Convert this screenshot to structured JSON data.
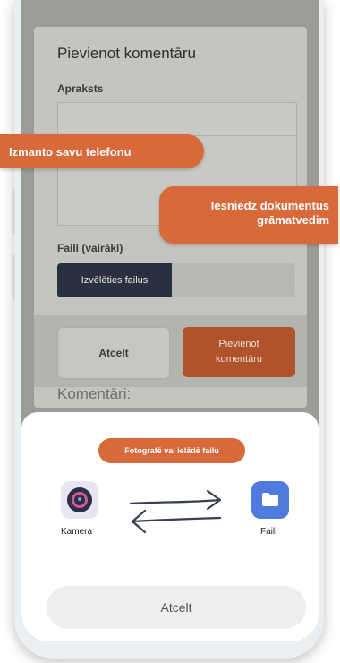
{
  "dialog": {
    "title": "Pievienot komentāru",
    "description_label": "Apraksts",
    "files_label": "Faili (vairāki)",
    "choose_files_button": "Izvēlēties failus",
    "cancel_button": "Atcelt",
    "submit_button_line1": "Pievienot",
    "submit_button_line2": "komentāru"
  },
  "comments_heading": "Komentāri:",
  "callouts": {
    "use_phone": "Izmanto savu telefonu",
    "submit_docs_line1": "Iesniedz dokumentus",
    "submit_docs_line2": "grāmatvedim"
  },
  "sheet": {
    "pill_text": "Fotografē vai ielādē failu",
    "camera_label": "Kamera",
    "camera_icon": "camera-icon",
    "files_label": "Faili",
    "files_icon": "folder-icon",
    "cancel_button": "Atcelt"
  },
  "colors": {
    "accent": "#d8693b",
    "submit": "#b0532a",
    "files_icon_bg": "#4f7bdc",
    "file_button": "#2b3040"
  }
}
